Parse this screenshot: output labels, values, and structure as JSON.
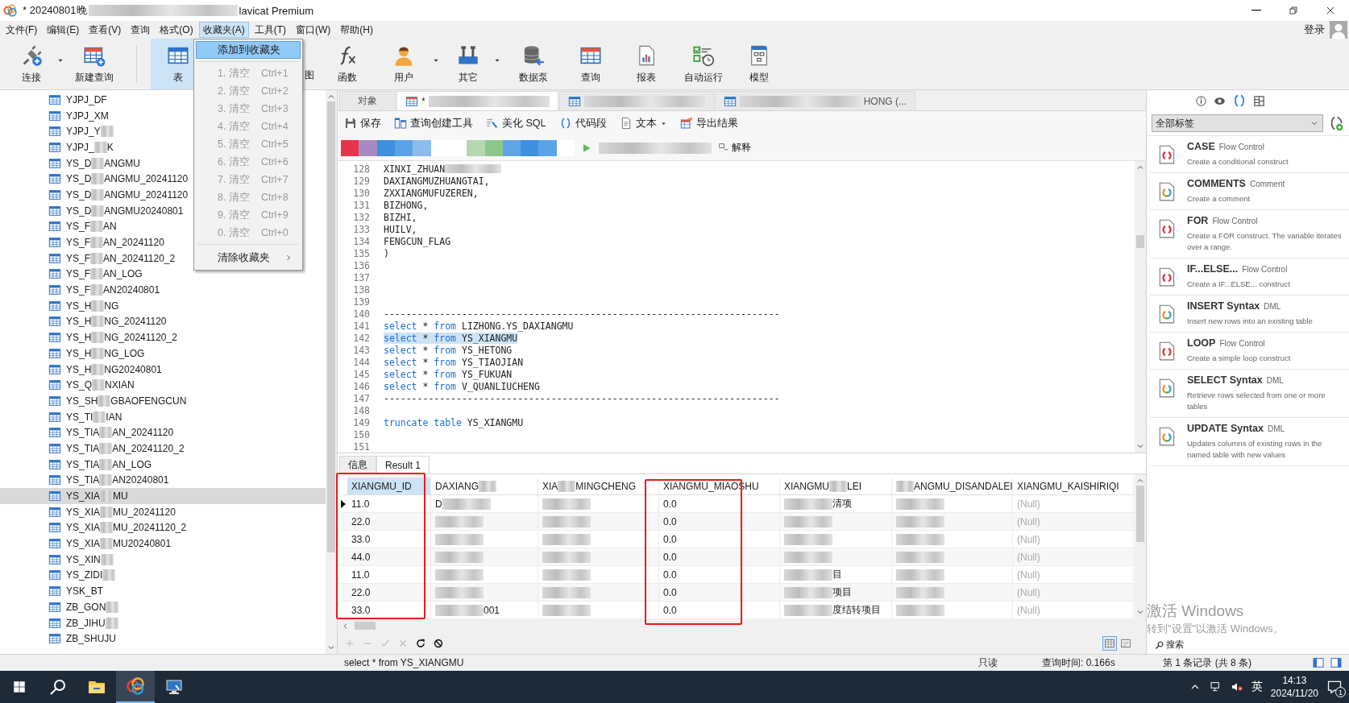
{
  "window": {
    "title_before": "* 20240801晚",
    "title_after": "lavicat Premium"
  },
  "menu_bar": [
    {
      "label": "文件(F)",
      "selected": false
    },
    {
      "label": "编辑(E)",
      "selected": false
    },
    {
      "label": "查看(V)",
      "selected": false
    },
    {
      "label": "查询",
      "selected": false
    },
    {
      "label": "格式(O)",
      "selected": false
    },
    {
      "label": "收藏夹(A)",
      "selected": true
    },
    {
      "label": "工具(T)",
      "selected": false
    },
    {
      "label": "窗口(W)",
      "selected": false
    },
    {
      "label": "帮助(H)",
      "selected": false
    }
  ],
  "account": {
    "label": "登录"
  },
  "toolbar": [
    {
      "label": "连接",
      "dropdown": true,
      "selected": false
    },
    {
      "label": "新建查询",
      "dropdown": false,
      "selected": false
    },
    {
      "label": "表",
      "dropdown": false,
      "selected": true
    },
    {
      "label": "图",
      "dropdown": false,
      "selected": false
    },
    {
      "label": "函数",
      "dropdown": false,
      "selected": false
    },
    {
      "label": "用户",
      "dropdown": true,
      "selected": false
    },
    {
      "label": "其它",
      "dropdown": true,
      "selected": false
    },
    {
      "label": "数据泵",
      "dropdown": false,
      "selected": false
    },
    {
      "label": "查询",
      "dropdown": false,
      "selected": false
    },
    {
      "label": "报表",
      "dropdown": false,
      "selected": false
    },
    {
      "label": "自动运行",
      "dropdown": false,
      "selected": false
    },
    {
      "label": "模型",
      "dropdown": false,
      "selected": false
    }
  ],
  "favorites_menu": [
    {
      "kind": "action",
      "label": "添加到收藏夹",
      "highlighted": true,
      "disabled": false
    },
    {
      "kind": "slot",
      "label": "1. 清空",
      "shortcut": "Ctrl+1",
      "highlighted": false,
      "disabled": true
    },
    {
      "kind": "slot",
      "label": "2. 清空",
      "shortcut": "Ctrl+2",
      "highlighted": false,
      "disabled": true
    },
    {
      "kind": "slot",
      "label": "3. 清空",
      "shortcut": "Ctrl+3",
      "highlighted": false,
      "disabled": true
    },
    {
      "kind": "slot",
      "label": "4. 清空",
      "shortcut": "Ctrl+4",
      "highlighted": false,
      "disabled": true
    },
    {
      "kind": "slot",
      "label": "5. 清空",
      "shortcut": "Ctrl+5",
      "highlighted": false,
      "disabled": true
    },
    {
      "kind": "slot",
      "label": "6. 清空",
      "shortcut": "Ctrl+6",
      "highlighted": false,
      "disabled": true
    },
    {
      "kind": "slot",
      "label": "7. 清空",
      "shortcut": "Ctrl+7",
      "highlighted": false,
      "disabled": true
    },
    {
      "kind": "slot",
      "label": "8. 清空",
      "shortcut": "Ctrl+8",
      "highlighted": false,
      "disabled": true
    },
    {
      "kind": "slot",
      "label": "9. 清空",
      "shortcut": "Ctrl+9",
      "highlighted": false,
      "disabled": true
    },
    {
      "kind": "slot",
      "label": "0. 清空",
      "shortcut": "Ctrl+0",
      "highlighted": false,
      "disabled": true
    },
    {
      "kind": "submenu",
      "label": "清除收藏夹",
      "highlighted": false,
      "disabled": false
    }
  ],
  "tree": [
    {
      "redacted": false,
      "text": "YJPJ_DF",
      "selected": false
    },
    {
      "redacted": false,
      "text": "YJPJ_XM",
      "selected": false
    },
    {
      "redacted": true,
      "before": "YJPJ_Y",
      "selected": false
    },
    {
      "redacted": true,
      "before": "YJPJ_",
      "after": "K",
      "selected": false
    },
    {
      "redacted": true,
      "before": "YS_D",
      "after": "ANGMU",
      "selected": false
    },
    {
      "redacted": true,
      "before": "YS_D",
      "after": "ANGMU_20241120",
      "selected": false
    },
    {
      "redacted": true,
      "before": "YS_D",
      "after": "ANGMU_20241120",
      "selected": false
    },
    {
      "redacted": true,
      "before": "YS_D",
      "after": "ANGMU20240801",
      "selected": false
    },
    {
      "redacted": true,
      "before": "YS_F",
      "after": "AN",
      "selected": false
    },
    {
      "redacted": true,
      "before": "YS_F",
      "after": "AN_20241120",
      "selected": false
    },
    {
      "redacted": true,
      "before": "YS_F",
      "after": "AN_20241120_2",
      "selected": false
    },
    {
      "redacted": true,
      "before": "YS_F",
      "after": "AN_LOG",
      "selected": false
    },
    {
      "redacted": true,
      "before": "YS_F",
      "after": "AN20240801",
      "selected": false
    },
    {
      "redacted": true,
      "before": "YS_H",
      "after": "NG",
      "selected": false
    },
    {
      "redacted": true,
      "before": "YS_H",
      "after": "NG_20241120",
      "selected": false
    },
    {
      "redacted": true,
      "before": "YS_H",
      "after": "NG_20241120_2",
      "selected": false
    },
    {
      "redacted": true,
      "before": "YS_H",
      "after": "NG_LOG",
      "selected": false
    },
    {
      "redacted": true,
      "before": "YS_H",
      "after": "NG20240801",
      "selected": false
    },
    {
      "redacted": true,
      "before": "YS_Q",
      "after": "NXIAN",
      "selected": false
    },
    {
      "redacted": true,
      "before": "YS_SH",
      "after": "GBAOFENGCUN",
      "selected": false
    },
    {
      "redacted": true,
      "before": "YS_TI",
      "after": "IAN",
      "selected": false
    },
    {
      "redacted": true,
      "before": "YS_TIA",
      "after": "AN_20241120",
      "selected": false
    },
    {
      "redacted": true,
      "before": "YS_TIA",
      "after": "AN_20241120_2",
      "selected": false
    },
    {
      "redacted": true,
      "before": "YS_TIA",
      "after": "AN_LOG",
      "selected": false
    },
    {
      "redacted": true,
      "before": "YS_TIA",
      "after": "AN20240801",
      "selected": false
    },
    {
      "redacted": true,
      "before": "YS_XIA",
      "after": "MU",
      "selected": true
    },
    {
      "redacted": true,
      "before": "YS_XIA",
      "after": "MU_20241120",
      "selected": false
    },
    {
      "redacted": true,
      "before": "YS_XIA",
      "after": "MU_20241120_2",
      "selected": false
    },
    {
      "redacted": true,
      "before": "YS_XIA",
      "after": "MU20240801",
      "selected": false
    },
    {
      "redacted": true,
      "before": "YS_XIN",
      "selected": false
    },
    {
      "redacted": true,
      "before": "YS_ZIDI",
      "selected": false
    },
    {
      "redacted": false,
      "text": "YSK_BT",
      "selected": false
    },
    {
      "redacted": true,
      "before": "ZB_GON",
      "selected": false
    },
    {
      "redacted": true,
      "before": "ZB_JIHU",
      "selected": false
    },
    {
      "redacted": false,
      "text": "ZB_SHUJU",
      "selected": false
    }
  ],
  "editor_tabs": [
    {
      "kind": "objects",
      "redacted": false,
      "text": "对象",
      "selected": false
    },
    {
      "kind": "query",
      "redacted": true,
      "before": "*",
      "selected": true
    },
    {
      "kind": "table",
      "redacted": true,
      "selected": false
    },
    {
      "kind": "other",
      "redacted": true,
      "after": "HONG (...",
      "selected": false
    }
  ],
  "editor_toolbar": [
    {
      "label": "保存",
      "dropdown": false
    },
    {
      "label": "查询创建工具",
      "dropdown": false
    },
    {
      "label": "美化 SQL",
      "dropdown": false
    },
    {
      "label": "代码段",
      "dropdown": false
    },
    {
      "label": "文本",
      "dropdown": true
    },
    {
      "label": "导出结果",
      "dropdown": false
    }
  ],
  "run_bar": {
    "explain": "解释"
  },
  "code": [
    {
      "num": "128",
      "selected": false,
      "redacted": true,
      "tokens": [
        {
          "text": "XINXI_ZHUAN",
          "keyword": false
        }
      ]
    },
    {
      "num": "129",
      "selected": false,
      "redacted": false,
      "tokens": [
        {
          "text": "DAXIANGMUZHUANGTAI,",
          "keyword": false
        }
      ]
    },
    {
      "num": "130",
      "selected": false,
      "redacted": false,
      "tokens": [
        {
          "text": "ZXXIANGMUFUZEREN,",
          "keyword": false
        }
      ]
    },
    {
      "num": "131",
      "selected": false,
      "redacted": false,
      "tokens": [
        {
          "text": "BIZHONG,",
          "keyword": false
        }
      ]
    },
    {
      "num": "132",
      "selected": false,
      "redacted": false,
      "tokens": [
        {
          "text": "BIZHI,",
          "keyword": false
        }
      ]
    },
    {
      "num": "133",
      "selected": false,
      "redacted": false,
      "tokens": [
        {
          "text": "HUILV,",
          "keyword": false
        }
      ]
    },
    {
      "num": "134",
      "selected": false,
      "redacted": false,
      "tokens": [
        {
          "text": "FENGCUN_FLAG",
          "keyword": false
        }
      ]
    },
    {
      "num": "135",
      "selected": false,
      "redacted": false,
      "tokens": [
        {
          "text": ")",
          "keyword": false
        }
      ]
    },
    {
      "num": "136",
      "selected": false,
      "redacted": false
    },
    {
      "num": "137",
      "selected": false,
      "redacted": false
    },
    {
      "num": "138",
      "selected": false,
      "redacted": false
    },
    {
      "num": "139",
      "selected": false,
      "redacted": false
    },
    {
      "num": "140",
      "selected": false,
      "redacted": false,
      "tokens": [
        {
          "text": "-----------------------------------------------------------------------",
          "keyword": false
        }
      ]
    },
    {
      "num": "141",
      "selected": false,
      "redacted": false,
      "tokens": [
        {
          "text": "select",
          "keyword": true
        },
        {
          "text": " * ",
          "keyword": false
        },
        {
          "text": "from",
          "keyword": true
        },
        {
          "text": " LIZHONG.YS_DAXIANGMU",
          "keyword": false
        }
      ]
    },
    {
      "num": "142",
      "selected": true,
      "redacted": false,
      "tokens": [
        {
          "text": "select",
          "keyword": true
        },
        {
          "text": " * ",
          "keyword": false
        },
        {
          "text": "from",
          "keyword": true
        },
        {
          "text": " YS_XIANGMU",
          "keyword": false
        }
      ]
    },
    {
      "num": "143",
      "selected": false,
      "redacted": false,
      "tokens": [
        {
          "text": "select",
          "keyword": true
        },
        {
          "text": " * ",
          "keyword": false
        },
        {
          "text": "from",
          "keyword": true
        },
        {
          "text": " YS_HETONG",
          "keyword": false
        }
      ]
    },
    {
      "num": "144",
      "selected": false,
      "redacted": false,
      "tokens": [
        {
          "text": "select",
          "keyword": true
        },
        {
          "text": " * ",
          "keyword": false
        },
        {
          "text": "from",
          "keyword": true
        },
        {
          "text": " YS_TIAOJIAN",
          "keyword": false
        }
      ]
    },
    {
      "num": "145",
      "selected": false,
      "redacted": false,
      "tokens": [
        {
          "text": "select",
          "keyword": true
        },
        {
          "text": " * ",
          "keyword": false
        },
        {
          "text": "from",
          "keyword": true
        },
        {
          "text": " YS_FUKUAN",
          "keyword": false
        }
      ]
    },
    {
      "num": "146",
      "selected": false,
      "redacted": false,
      "tokens": [
        {
          "text": "select",
          "keyword": true
        },
        {
          "text": " * ",
          "keyword": false
        },
        {
          "text": "from",
          "keyword": true
        },
        {
          "text": " V_QUANLIUCHENG",
          "keyword": false
        }
      ]
    },
    {
      "num": "147",
      "selected": false,
      "redacted": false,
      "tokens": [
        {
          "text": "-----------------------------------------------------------------------",
          "keyword": false
        }
      ]
    },
    {
      "num": "148",
      "selected": false,
      "redacted": false
    },
    {
      "num": "149",
      "selected": false,
      "redacted": false,
      "tokens": [
        {
          "text": "truncate",
          "keyword": true
        },
        {
          "text": " table",
          "keyword": true
        },
        {
          "text": " YS_XIANGMU",
          "keyword": false
        }
      ]
    },
    {
      "num": "150",
      "selected": false,
      "redacted": false
    },
    {
      "num": "151",
      "selected": false,
      "redacted": false
    }
  ],
  "result_tabs": [
    {
      "label": "信息",
      "selected": false
    },
    {
      "label": "Result 1",
      "selected": true
    }
  ],
  "grid": {
    "columns": [
      {
        "redacted": false,
        "text": "XIANGMU_ID",
        "selected": true
      },
      {
        "redacted": true,
        "before": "DAXIANG",
        "selected": false
      },
      {
        "redacted": true,
        "before": "XIA",
        "after": "MINGCHENG",
        "selected": false
      },
      {
        "redacted": false,
        "text": "XIANGMU_MIAOSHU",
        "selected": false
      },
      {
        "redacted": true,
        "before": "XIANGMU",
        "after": "LEI",
        "selected": false
      },
      {
        "redacted": true,
        "after": "ANGMU_DISANDALEI",
        "selected": false
      },
      {
        "redacted": false,
        "text": "XIANGMU_KAISHIRIQI",
        "selected": false
      }
    ],
    "rows": [
      {
        "current": true,
        "cells": [
          {
            "kind": "text",
            "text": "11.0"
          },
          {
            "kind": "redacted",
            "before": "D"
          },
          {
            "kind": "redacted"
          },
          {
            "kind": "text",
            "text": "0.0"
          },
          {
            "kind": "redacted",
            "after": "清项"
          },
          {
            "kind": "redacted"
          },
          {
            "kind": "null",
            "text": "(Null)"
          }
        ]
      },
      {
        "current": false,
        "cells": [
          {
            "kind": "text",
            "text": "22.0"
          },
          {
            "kind": "redacted"
          },
          {
            "kind": "redacted"
          },
          {
            "kind": "text",
            "text": "0.0"
          },
          {
            "kind": "redacted"
          },
          {
            "kind": "redacted"
          },
          {
            "kind": "null",
            "text": "(Null)"
          }
        ]
      },
      {
        "current": false,
        "cells": [
          {
            "kind": "text",
            "text": "33.0"
          },
          {
            "kind": "redacted"
          },
          {
            "kind": "redacted"
          },
          {
            "kind": "text",
            "text": "0.0"
          },
          {
            "kind": "redacted"
          },
          {
            "kind": "redacted"
          },
          {
            "kind": "null",
            "text": "(Null)"
          }
        ]
      },
      {
        "current": false,
        "cells": [
          {
            "kind": "text",
            "text": "44.0"
          },
          {
            "kind": "redacted"
          },
          {
            "kind": "redacted"
          },
          {
            "kind": "text",
            "text": "0.0"
          },
          {
            "kind": "redacted"
          },
          {
            "kind": "redacted"
          },
          {
            "kind": "null",
            "text": "(Null)"
          }
        ]
      },
      {
        "current": false,
        "cells": [
          {
            "kind": "text",
            "text": "11.0"
          },
          {
            "kind": "redacted"
          },
          {
            "kind": "redacted"
          },
          {
            "kind": "text",
            "text": "0.0"
          },
          {
            "kind": "redacted",
            "after": "目"
          },
          {
            "kind": "redacted"
          },
          {
            "kind": "null",
            "text": "(Null)"
          }
        ]
      },
      {
        "current": false,
        "cells": [
          {
            "kind": "text",
            "text": "22.0"
          },
          {
            "kind": "redacted"
          },
          {
            "kind": "redacted"
          },
          {
            "kind": "text",
            "text": "0.0"
          },
          {
            "kind": "redacted",
            "after": "项目"
          },
          {
            "kind": "redacted"
          },
          {
            "kind": "null",
            "text": "(Null)"
          }
        ]
      },
      {
        "current": false,
        "cells": [
          {
            "kind": "text",
            "text": "33.0"
          },
          {
            "kind": "redacted",
            "after": "001"
          },
          {
            "kind": "redacted"
          },
          {
            "kind": "text",
            "text": "0.0"
          },
          {
            "kind": "redacted",
            "after": "度结转项目"
          },
          {
            "kind": "redacted"
          },
          {
            "kind": "null",
            "text": "(Null)"
          }
        ]
      }
    ]
  },
  "grid_tools": [
    {
      "disabled": true
    },
    {
      "disabled": true
    },
    {
      "disabled": true
    },
    {
      "disabled": true
    },
    {
      "disabled": false
    },
    {
      "disabled": false
    }
  ],
  "view_toggles": [
    {
      "selected": true
    },
    {
      "selected": false
    }
  ],
  "side_panel": {
    "tabs": [
      {
        "selected": false
      },
      {
        "selected": false
      },
      {
        "selected": true
      },
      {
        "selected": false
      }
    ],
    "tag_filter": "全部标签",
    "snippets": [
      {
        "kind": "control",
        "title": "CASE",
        "category": "Flow Control",
        "description": "Create a conditional construct"
      },
      {
        "kind": "general",
        "title": "COMMENTS",
        "category": "Comment",
        "description": "Create a comment"
      },
      {
        "kind": "control",
        "title": "FOR",
        "category": "Flow Control",
        "description": "Create a FOR construct. The variable iterates over a range."
      },
      {
        "kind": "control",
        "title": "IF...ELSE...",
        "category": "Flow Control",
        "description": "Create a IF...ELSE... construct"
      },
      {
        "kind": "general",
        "title": "INSERT Syntax",
        "category": "DML",
        "description": "Insert new rows into an existing table"
      },
      {
        "kind": "control",
        "title": "LOOP",
        "category": "Flow Control",
        "description": "Create a simple loop construct"
      },
      {
        "kind": "general",
        "title": "SELECT Syntax",
        "category": "DML",
        "description": "Retrieve rows selected from one or more tables"
      },
      {
        "kind": "general",
        "title": "UPDATE Syntax",
        "category": "DML",
        "description": "Updates columns of existing rows in the named table with new values"
      }
    ],
    "search": "搜索"
  },
  "status_bar": {
    "sql": "select * from YS_XIANGMU",
    "mode": "只读",
    "time": "查询时间: 0.166s",
    "records": "第 1 条记录 (共 8 条)"
  },
  "activation_notice": {
    "title": "激活 Windows",
    "hint": "转到\"设置\"以激活 Windows。"
  },
  "taskbar": {
    "apps": [
      {
        "selected": false
      },
      {
        "selected": false
      },
      {
        "selected": false
      },
      {
        "selected": true
      },
      {
        "selected": false
      }
    ],
    "ime": "英",
    "time": "14:13",
    "date": "2024/11/20",
    "notifications": "1"
  }
}
